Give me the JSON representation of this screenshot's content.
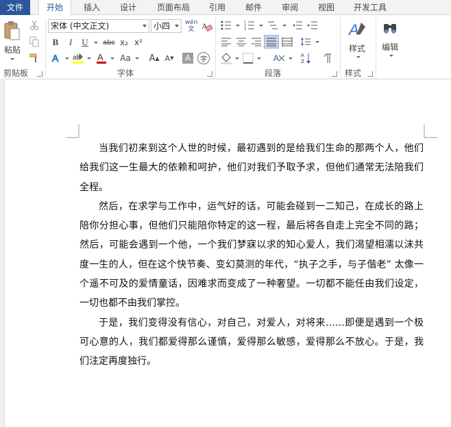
{
  "tabs": [
    "文件",
    "开始",
    "插入",
    "设计",
    "页面布局",
    "引用",
    "邮件",
    "审阅",
    "视图",
    "开发工具"
  ],
  "clipboard": {
    "paste": "粘贴",
    "group": "剪贴板"
  },
  "font": {
    "name": "宋体 (中文正文)",
    "size": "小四",
    "group": "字体",
    "bold": "B",
    "italic": "I",
    "underline": "U",
    "strike": "abc",
    "sub": "x₂",
    "sup": "x²",
    "case": "Aa",
    "grow": "A",
    "shrink": "A",
    "wen": "wén",
    "wen_char": "文",
    "char_shade": "A",
    "enclose": "字"
  },
  "paragraph": {
    "group": "段落"
  },
  "styles": {
    "label": "样式",
    "group": "样式"
  },
  "editing": {
    "label": "编辑"
  },
  "colors": {
    "accent": "#2b579a",
    "highlight": "#ffff00",
    "font_color": "#c00000"
  },
  "document": {
    "paragraphs": [
      "当我们初来到这个人世的时候，最初遇到的是给我们生命的那两个人，他们给我们这一生最大的依赖和呵护，他们对我们予取予求，但他们通常无法陪我们全程。",
      "然后，在求学与工作中，运气好的话，可能会碰到一二知己，在成长的路上陪你分担心事，但他们只能陪你特定的这一程，最后将各自走上完全不同的路；然后，可能会遇到一个他，一个我们梦寐以求的知心爱人，我们渴望相濡以沫共度一生的人，但在这个快节奏、变幻莫测的年代，“执子之手，与子偕老” 太像一个遥不可及的爱情童话，因难求而变成了一种奢望。一切都不能任由我们设定，一切也都不由我们掌控。",
      "于是，我们变得没有信心，对自己，对爱人，对将来……即便是遇到一个极可心意的人，我们都爱得那么谨慎，爱得那么敏感，爱得那么不放心。于是，我们注定再度独行。"
    ]
  }
}
